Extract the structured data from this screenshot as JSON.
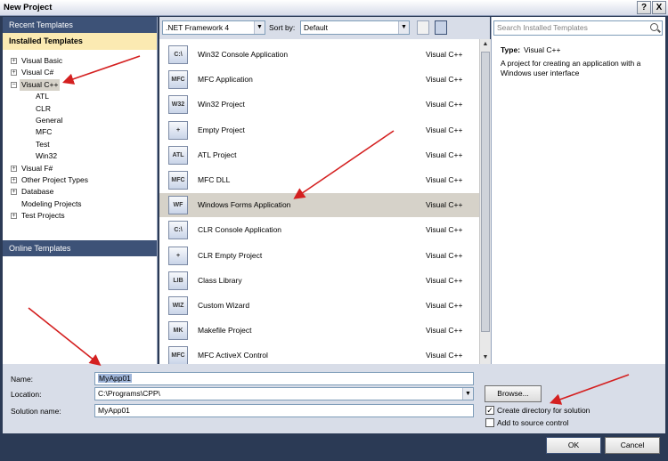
{
  "window": {
    "title": "New Project",
    "help": "?",
    "close": "X"
  },
  "left": {
    "recent": "Recent Templates",
    "installed": "Installed Templates",
    "online": "Online Templates",
    "tree": [
      {
        "label": "Visual Basic",
        "level": 0,
        "expander": "+"
      },
      {
        "label": "Visual C#",
        "level": 0,
        "expander": "+"
      },
      {
        "label": "Visual C++",
        "level": 0,
        "expander": "−",
        "selected": true
      },
      {
        "label": "ATL",
        "level": 1
      },
      {
        "label": "CLR",
        "level": 1
      },
      {
        "label": "General",
        "level": 1
      },
      {
        "label": "MFC",
        "level": 1
      },
      {
        "label": "Test",
        "level": 1
      },
      {
        "label": "Win32",
        "level": 1
      },
      {
        "label": "Visual F#",
        "level": 0,
        "expander": "+"
      },
      {
        "label": "Other Project Types",
        "level": 0,
        "expander": "+"
      },
      {
        "label": "Database",
        "level": 0,
        "expander": "+"
      },
      {
        "label": "Modeling Projects",
        "level": 0
      },
      {
        "label": "Test Projects",
        "level": 0,
        "expander": "+"
      }
    ]
  },
  "toolbar": {
    "framework": ".NET Framework 4",
    "sort_label": "Sort by:",
    "sort_value": "Default"
  },
  "templates": [
    {
      "name": "Win32 Console Application",
      "lang": "Visual C++",
      "icon": "C:\\"
    },
    {
      "name": "MFC Application",
      "lang": "Visual C++",
      "icon": "MFC"
    },
    {
      "name": "Win32 Project",
      "lang": "Visual C++",
      "icon": "W32"
    },
    {
      "name": "Empty Project",
      "lang": "Visual C++",
      "icon": "+"
    },
    {
      "name": "ATL Project",
      "lang": "Visual C++",
      "icon": "ATL"
    },
    {
      "name": "MFC DLL",
      "lang": "Visual C++",
      "icon": "MFC"
    },
    {
      "name": "Windows Forms Application",
      "lang": "Visual C++",
      "icon": "WF",
      "selected": true
    },
    {
      "name": "CLR Console Application",
      "lang": "Visual C++",
      "icon": "C:\\"
    },
    {
      "name": "CLR Empty Project",
      "lang": "Visual C++",
      "icon": "+"
    },
    {
      "name": "Class Library",
      "lang": "Visual C++",
      "icon": "LIB"
    },
    {
      "name": "Custom Wizard",
      "lang": "Visual C++",
      "icon": "WIZ"
    },
    {
      "name": "Makefile Project",
      "lang": "Visual C++",
      "icon": "MK"
    },
    {
      "name": "MFC ActiveX Control",
      "lang": "Visual C++",
      "icon": "MFC"
    }
  ],
  "search": {
    "placeholder": "Search Installed Templates"
  },
  "description": {
    "type_label": "Type:",
    "type_value": "Visual C++",
    "text": "A project for creating an application with a Windows user interface"
  },
  "form": {
    "name_label": "Name:",
    "name_value": "MyApp01",
    "location_label": "Location:",
    "location_value": "C:\\Programs\\CPP\\",
    "solution_label": "Solution name:",
    "solution_value": "MyApp01",
    "browse": "Browse...",
    "create_dir": "Create directory for solution",
    "create_dir_checked": true,
    "source_control": "Add to source control",
    "source_control_checked": false
  },
  "buttons": {
    "ok": "OK",
    "cancel": "Cancel"
  },
  "colors": {
    "annotation_arrow": "#d42020",
    "section_dark": "#3d5277",
    "selection": "#d6d2c9"
  }
}
